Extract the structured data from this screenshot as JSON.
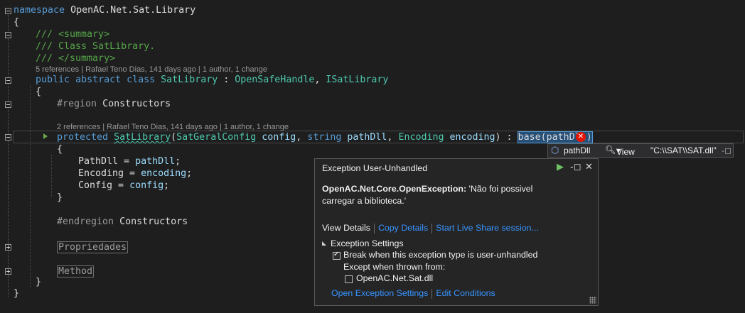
{
  "code": {
    "l1": {
      "kw": "namespace",
      "name": "OpenAC.Net.Sat.Library"
    },
    "open_brace": "{",
    "close_brace": "}",
    "doc1": "/// <summary>",
    "doc2": "/// Class SatLibrary.",
    "doc3": "/// </summary>",
    "lens1": "5 references | Rafael Teno Dias, 141 days ago | 1 author, 1 change",
    "class_decl": {
      "kw1": "public",
      "kw2": "abstract",
      "kw3": "class",
      "name": "SatLibrary",
      "sep": " : ",
      "base1": "OpenSafeHandle",
      "comma": ", ",
      "base2": "ISatLibrary"
    },
    "region_start": {
      "kw": "#region",
      "name": "Constructors"
    },
    "lens2": "2 references | Rafael Teno Dias, 141 days ago | 1 author, 1 change",
    "ctor": {
      "kw": "protected",
      "name": "SatLibrary",
      "open": "(",
      "t1": "SatGeralConfig",
      "p1": "config",
      "c1": ", ",
      "t2": "string",
      "p2": "pathDll",
      "c2": ", ",
      "t3": "Encoding",
      "p3": "encoding",
      "close": ") : ",
      "base": "base(pathDll)"
    },
    "body1": {
      "lhs": "PathDll",
      "eq": " = ",
      "rhs": "pathDll",
      "end": ";"
    },
    "body2": {
      "lhs": "Encoding",
      "eq": " = ",
      "rhs": "encoding",
      "end": ";"
    },
    "body3": {
      "lhs": "Config",
      "eq": " = ",
      "rhs": "config",
      "end": ";"
    },
    "region_end": {
      "kw": "#endregion",
      "name": "Constructors"
    },
    "collapsed1": "Propriedades",
    "collapsed2": "Method"
  },
  "datatip": {
    "name": "pathDll",
    "view": "View",
    "value": "\"C:\\\\SAT\\\\SAT.dll\""
  },
  "exception_popup": {
    "title": "Exception User-Unhandled",
    "exception_type": "OpenAC.Net.Core.OpenException:",
    "message": " 'Não foi possivel carregar a biblioteca.'",
    "view_details": "View Details",
    "copy_details": "Copy Details",
    "live_share": "Start Live Share session...",
    "settings_header": "Exception Settings",
    "break_when": "Break when this exception type is user-unhandled",
    "except_when": "Except when thrown from:",
    "module": "OpenAC.Net.Sat.dll",
    "open_settings": "Open Exception Settings",
    "edit_conditions": "Edit Conditions",
    "break_checked": true,
    "module_checked": false
  },
  "colors": {
    "keyword": "#569cd6",
    "type": "#4ec9b0",
    "comment": "#57a64a",
    "param": "#9cdcfe",
    "link": "#3794ff",
    "error": "#e51400"
  }
}
